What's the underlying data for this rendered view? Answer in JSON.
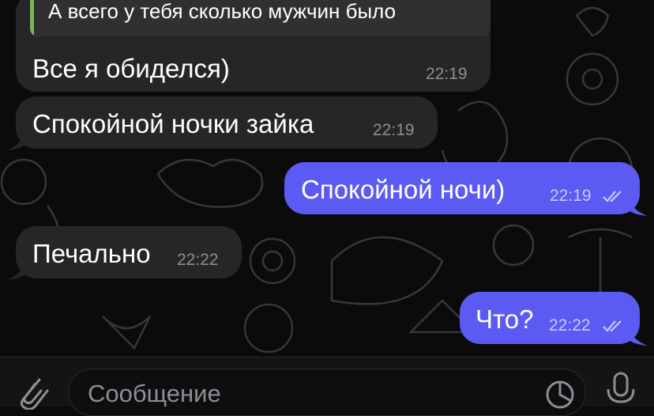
{
  "quote": {
    "text": "А всего у тебя сколько мужчин было"
  },
  "messages": [
    {
      "text": "Все я обиделся)",
      "time": "22:19",
      "direction": "incoming"
    },
    {
      "text": "Спокойной ночки зайка",
      "time": "22:19",
      "direction": "incoming"
    },
    {
      "text": "Спокойной ночи)",
      "time": "22:19",
      "direction": "outgoing",
      "status": "read"
    },
    {
      "text": "Печально",
      "time": "22:22",
      "direction": "incoming"
    },
    {
      "text": "Что?",
      "time": "22:22",
      "direction": "outgoing",
      "status": "read"
    }
  ],
  "composer": {
    "placeholder": "Сообщение"
  },
  "icons": {
    "attach": "paperclip-icon",
    "sticker": "sticker-icon",
    "mic": "microphone-icon",
    "read": "double-check-icon"
  },
  "colors": {
    "outgoing_bubble": "#5b5bf3",
    "incoming_bubble": "#262628",
    "reply_bar": "#7ab65a",
    "background": "#0b0b0c"
  }
}
